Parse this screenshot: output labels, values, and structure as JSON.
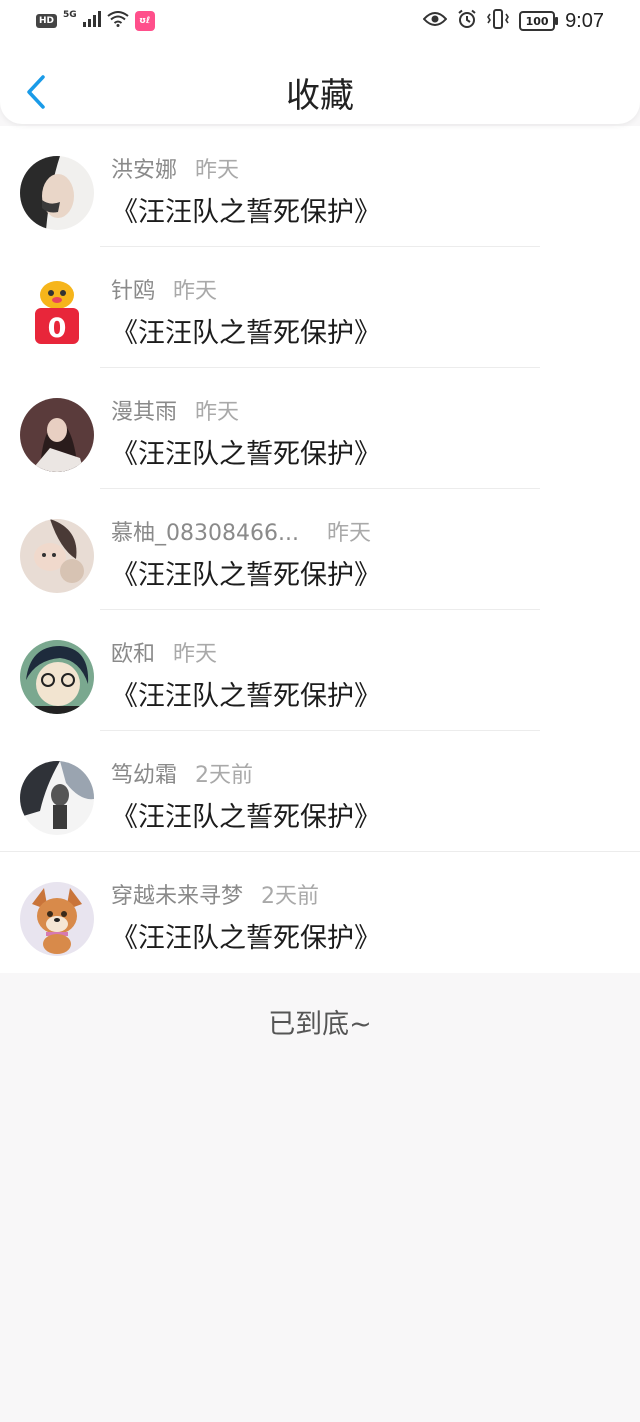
{
  "status_bar": {
    "left": {
      "hd": "HD",
      "network": "5G",
      "app_badge": "ʊℓ"
    },
    "battery": "100",
    "time": "9:07",
    "icons": [
      "eye-icon",
      "alarm-icon",
      "vibrate-icon"
    ]
  },
  "nav": {
    "title": "收藏",
    "back_icon": "chevron-left-icon",
    "accent": "#1a9be8"
  },
  "favorites": [
    {
      "user": "洪安娜",
      "time": "昨天",
      "work": "《汪汪队之誓死保护》"
    },
    {
      "user": "针鸥",
      "time": "昨天",
      "work": "《汪汪队之誓死保护》",
      "avatar_badge": "0"
    },
    {
      "user": "漫其雨",
      "time": "昨天",
      "work": "《汪汪队之誓死保护》"
    },
    {
      "user": "慕柚_08308466...",
      "time": "昨天",
      "work": "《汪汪队之誓死保护》"
    },
    {
      "user": "欧和",
      "time": "昨天",
      "work": "《汪汪队之誓死保护》"
    },
    {
      "user": "笃幼霜",
      "time": "2天前",
      "work": "《汪汪队之誓死保护》"
    },
    {
      "user": "穿越未来寻梦",
      "time": "2天前",
      "work": "《汪汪队之誓死保护》"
    }
  ],
  "footer": {
    "end_text": "已到底~"
  }
}
